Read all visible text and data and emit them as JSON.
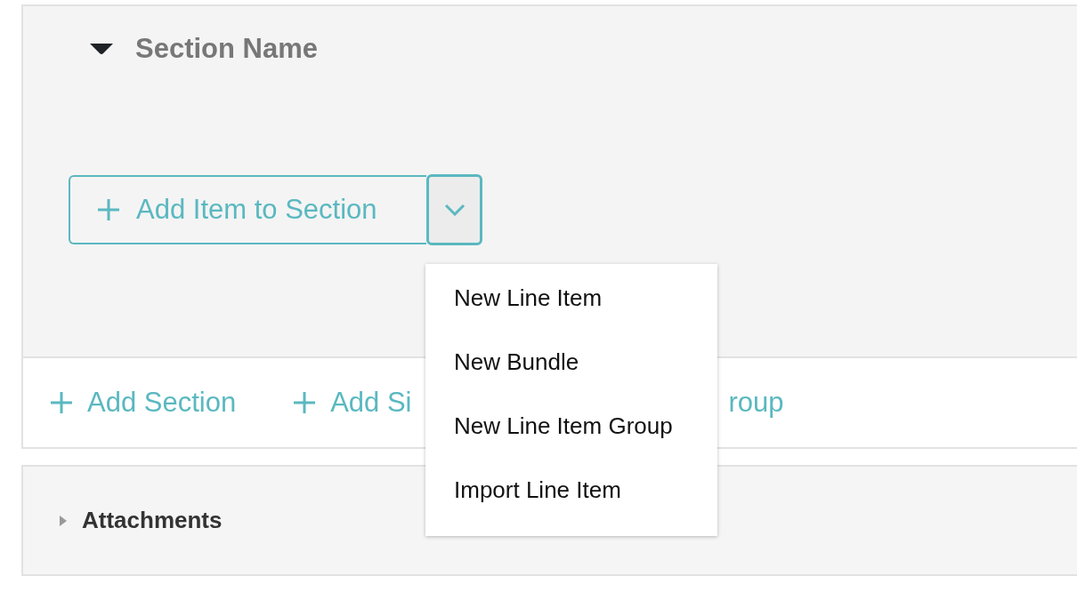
{
  "section": {
    "title": "Section Name",
    "expanded": true
  },
  "add_item_button": {
    "label": "Add Item to Section"
  },
  "dropdown_menu": {
    "open": true,
    "items": [
      {
        "label": "New Line Item"
      },
      {
        "label": "New Bundle"
      },
      {
        "label": "New Line Item Group"
      },
      {
        "label": "Import Line Item"
      }
    ]
  },
  "footer_links": [
    {
      "label": "Add Section"
    },
    {
      "label": "Add Si",
      "label_after_menu": "roup"
    }
  ],
  "attachments": {
    "title": "Attachments",
    "expanded": false
  }
}
